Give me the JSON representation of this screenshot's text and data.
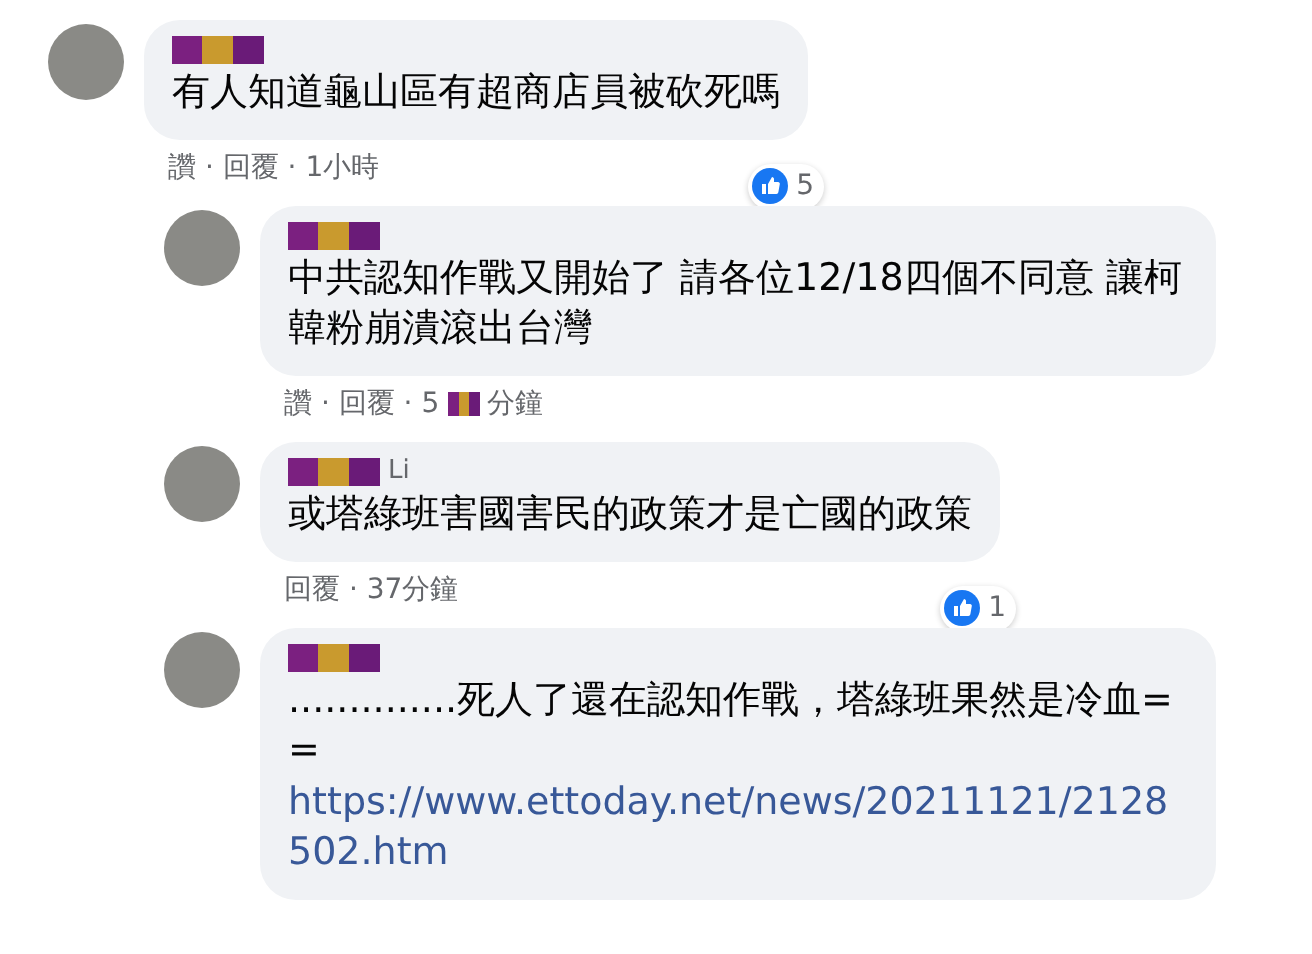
{
  "comments": [
    {
      "reply": false,
      "text_parts": [
        "有人知道龜山區有超商店員被砍死嗎"
      ],
      "meta": [
        "讚 · 回覆 · 1小時"
      ],
      "reactions": "5"
    },
    {
      "reply": true,
      "text_parts": [
        "中共認知作戰又開始了 請各位12/18四個不同意 讓柯韓粉崩潰滾出台灣"
      ],
      "meta": [
        "讚 · 回覆 · 5",
        "分鐘"
      ]
    },
    {
      "reply": true,
      "name": "Li",
      "text_parts": [
        "或塔綠班害國害民的政策才是亡國的政策"
      ],
      "meta": [
        "回覆 · 37分鐘"
      ],
      "reactions": "1"
    },
    {
      "reply": true,
      "text_parts": [
        "..............死人了還在認知作戰，塔綠班果然是冷血= ="
      ],
      "link": "https://www.ettoday.net/news/20211121/2128502.htm"
    }
  ]
}
